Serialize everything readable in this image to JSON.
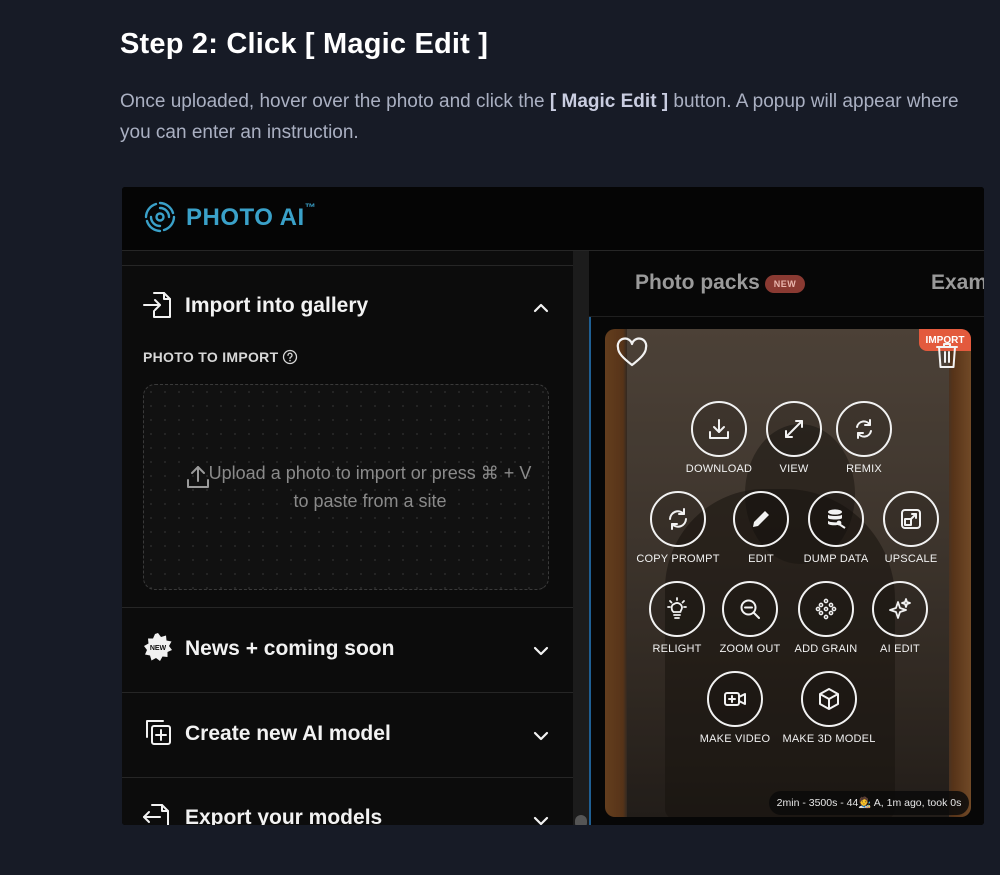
{
  "article": {
    "title": "Step 2: Click [ Magic Edit ]",
    "desc_before": "Once uploaded, hover over the photo and click the ",
    "desc_bold": "[ Magic Edit ]",
    "desc_after": " button. A popup will appear where you can enter an instruction."
  },
  "app": {
    "brand": "PHOTO AI",
    "brand_tm": "™",
    "accent": "#3aa1c9"
  },
  "sidebar": {
    "import": {
      "title": "Import into gallery",
      "photo_label": "PHOTO TO IMPORT",
      "drop_text": "Upload a photo to import or press ⌘ + V to paste from a site"
    },
    "sections": [
      {
        "title": "News + coming soon",
        "icon": "new-badge-icon"
      },
      {
        "title": "Create new AI model",
        "icon": "add-copy-icon"
      },
      {
        "title": "Export your models",
        "icon": "export-icon"
      }
    ]
  },
  "main": {
    "tabs": [
      {
        "label": "Photo packs",
        "badge": "NEW"
      },
      {
        "label": "Exam"
      }
    ],
    "photo": {
      "badge": "IMPORT",
      "actions": [
        {
          "label": "DOWNLOAD",
          "icon": "download-icon"
        },
        {
          "label": "VIEW",
          "icon": "expand-icon"
        },
        {
          "label": "REMIX",
          "icon": "refresh-icon"
        },
        {
          "label": "COPY PROMPT",
          "icon": "cycle-icon"
        },
        {
          "label": "EDIT",
          "icon": "pencil-icon"
        },
        {
          "label": "DUMP DATA",
          "icon": "database-icon"
        },
        {
          "label": "UPSCALE",
          "icon": "upscale-icon"
        },
        {
          "label": "RELIGHT",
          "icon": "bulb-icon"
        },
        {
          "label": "ZOOM OUT",
          "icon": "zoom-out-icon"
        },
        {
          "label": "ADD GRAIN",
          "icon": "grain-icon"
        },
        {
          "label": "AI EDIT",
          "icon": "sparkle-icon"
        },
        {
          "label": "MAKE VIDEO",
          "icon": "video-icon"
        },
        {
          "label": "MAKE 3D MODEL",
          "icon": "cube-icon"
        }
      ],
      "info": "2min - 3500s - 44🧑‍🎨 A, 1m ago, took 0s"
    }
  }
}
